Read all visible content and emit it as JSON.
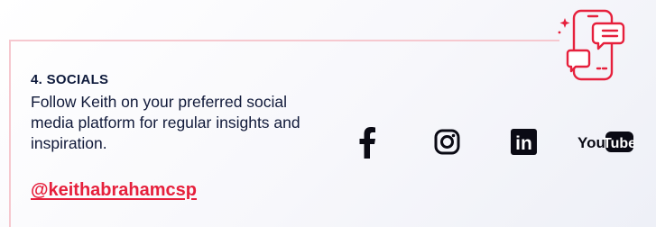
{
  "section": {
    "title": "4. SOCIALS",
    "description": "Follow Keith on your preferred social media platform for regular insights and inspiration.",
    "handle": "@keithabrahamcsp"
  },
  "social": {
    "icons": [
      "facebook-icon",
      "instagram-icon",
      "linkedin-icon",
      "youtube-icon"
    ],
    "youtube_wordmark_left": "You",
    "youtube_wordmark_right": "Tube",
    "linkedin_mark": "in"
  },
  "colors": {
    "accent_red": "#e6203c",
    "text_navy": "#111a3a",
    "rule_pink": "#f6c8cf"
  }
}
